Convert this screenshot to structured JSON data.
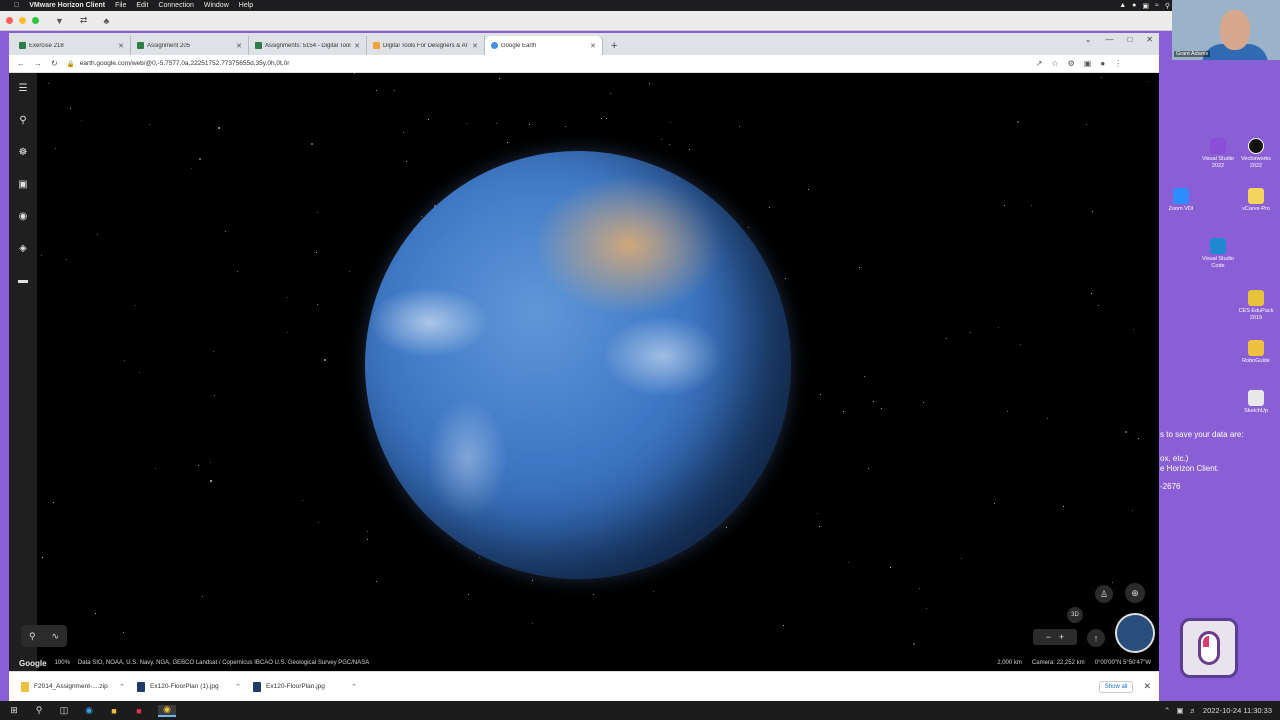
{
  "mac_menu": {
    "app_name": "VMware Horizon Client",
    "items": [
      "File",
      "Edit",
      "Connection",
      "Window",
      "Help"
    ]
  },
  "browser": {
    "tabs": [
      {
        "label": "Exercise 218",
        "active": false
      },
      {
        "label": "Assignment 205",
        "active": false
      },
      {
        "label": "Assignments: 5154 - Digital Tools",
        "active": false
      },
      {
        "label": "Digital Tools For Designers & Ar",
        "active": false
      },
      {
        "label": "Google Earth",
        "active": true
      }
    ],
    "url": "earth.google.com/web/@0,-5.7577,0a,22251752.77375655d,35y,0h,0t,0r"
  },
  "earth": {
    "attribution_logo": "Google",
    "zoom_percent": "100%",
    "data_sources": "Data SIO, NOAA, U.S. Navy, NGA, GEBCO  Landsat / Copernicus  IBCAO  U.S. Geological Survey  PGC/NASA",
    "scale": "2,000 km",
    "camera": "Camera: 22,252 km",
    "coordinates": "0°00'00\"N 5°50'47\"W",
    "view_3d_label": "3D"
  },
  "downloads": {
    "items": [
      {
        "name": "F2014_Assignment-....zip"
      },
      {
        "name": "Ex120-FloorPlan (1).jpg"
      },
      {
        "name": "Ex120-FloorPlan.jpg"
      }
    ],
    "show_all": "Show all"
  },
  "desktop": {
    "icons": [
      {
        "label": "Visual Studio 2022",
        "color": "#8a4fd6"
      },
      {
        "label": "Vectorworks 2022",
        "color": "#111111"
      },
      {
        "label": "Zoom VDI",
        "color": "#2d8cff"
      },
      {
        "label": "vCarve-Pro",
        "color": "#f4d35e"
      },
      {
        "label": "Visual Studio Code",
        "color": "#1f8ad2"
      },
      {
        "label": "CES EduPack 2019",
        "color": "#e8c23a"
      },
      {
        "label": "RoboGuide",
        "color": "#f0c040"
      },
      {
        "label": "SketchUp",
        "color": "#e8e8e8"
      }
    ],
    "text_line1": "s to save your data are:",
    "text_line2": "ox, etc.)",
    "text_line3": "e Horizon Client.",
    "text_line4": "-2676"
  },
  "webcam": {
    "name": "Grant Adams"
  },
  "taskbar": {
    "datetime": "2022-10-24  11:30:33"
  }
}
